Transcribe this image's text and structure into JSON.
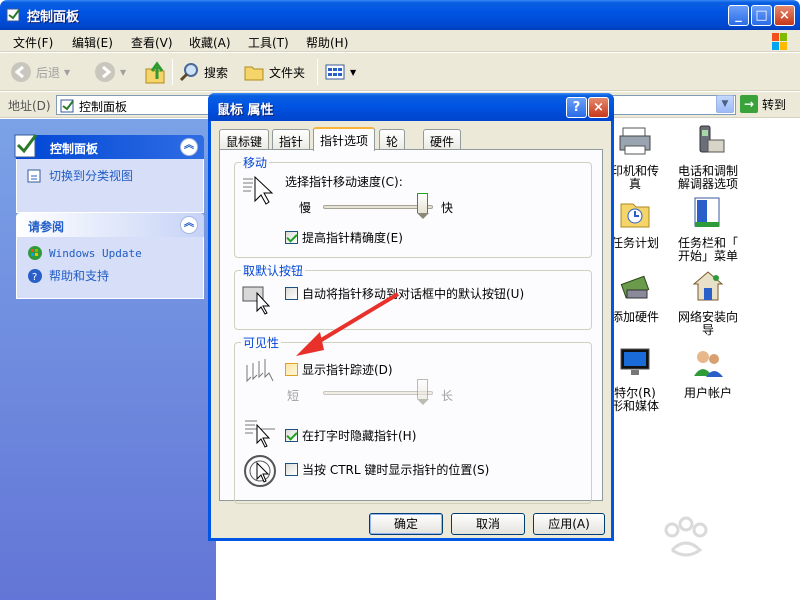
{
  "window": {
    "title": "控制面板"
  },
  "window_buttons": {
    "minimize": "_",
    "maximize": "□",
    "close": "×"
  },
  "menubar": [
    "文件(F)",
    "编辑(E)",
    "查看(V)",
    "收藏(A)",
    "工具(T)",
    "帮助(H)"
  ],
  "toolbar": {
    "back": "后退",
    "search": "搜索",
    "folders": "文件夹"
  },
  "address": {
    "label": "地址(D)",
    "value": "控制面板",
    "go": "转到"
  },
  "leftpane": {
    "control_panel": {
      "title": "控制面板",
      "link": "切换到分类视图"
    },
    "see_also": {
      "title": "请参阅",
      "links": [
        "Windows Update",
        "帮助和支持"
      ]
    }
  },
  "content_items": [
    {
      "label": "印机和传\n真",
      "icon": "printer-icon"
    },
    {
      "label": "电话和调制\n解调器选项",
      "icon": "phone-modem-icon"
    },
    {
      "label": "任务计划",
      "icon": "scheduled-tasks-icon"
    },
    {
      "label": "任务栏和「\n开始」菜单",
      "icon": "taskbar-icon"
    },
    {
      "label": "添加硬件",
      "icon": "add-hardware-icon"
    },
    {
      "label": "网络安装向\n导",
      "icon": "network-setup-icon"
    },
    {
      "label": "特尔(R)\n形和媒体",
      "icon": "intel-graphics-icon"
    },
    {
      "label": "用户帐户",
      "icon": "user-accounts-icon"
    }
  ],
  "dialog": {
    "title": "鼠标 属性",
    "tabs": [
      "鼠标键",
      "指针",
      "指针选项",
      "轮",
      "硬件"
    ],
    "active_tab": "指针选项",
    "motion": {
      "title": "移动",
      "speed_label": "选择指针移动速度(C):",
      "slow": "慢",
      "fast": "快",
      "speed_fraction": 0.9,
      "precision_label": "提高指针精确度(E)",
      "precision_checked": true
    },
    "snap_to": {
      "title": "取默认按钮",
      "label": "自动将指针移动到对话框中的默认按钮(U)",
      "checked": false
    },
    "visibility": {
      "title": "可见性",
      "trails_label": "显示指针踪迹(D)",
      "trails_checked": false,
      "short": "短",
      "long": "长",
      "trails_fraction": 0.9,
      "hide_label": "在打字时隐藏指针(H)",
      "hide_checked": true,
      "ctrl_label": "当按 CTRL 键时显示指针的位置(S)",
      "ctrl_checked": false
    },
    "buttons": {
      "ok": "确定",
      "cancel": "取消",
      "apply": "应用(A)"
    }
  },
  "colors": {
    "xp_blue": "#0054e3",
    "taskpane": "#6375d6",
    "annotation_red": "#e8312a"
  }
}
